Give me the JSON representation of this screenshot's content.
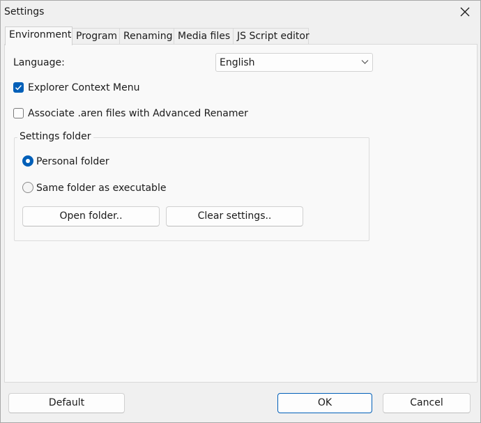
{
  "window": {
    "title": "Settings"
  },
  "icons": {
    "close": "close-icon",
    "dropdown": "chevron-down-icon",
    "check": "checkmark-icon"
  },
  "tabs": [
    {
      "label": "Environment",
      "active": true
    },
    {
      "label": "Program",
      "active": false
    },
    {
      "label": "Renaming",
      "active": false
    },
    {
      "label": "Media files",
      "active": false
    },
    {
      "label": "JS Script editor",
      "active": false
    }
  ],
  "environment": {
    "language_label": "Language:",
    "language_value": "English",
    "explorer_context_menu": {
      "label": "Explorer Context Menu",
      "checked": true
    },
    "associate_aren": {
      "label": "Associate .aren files with Advanced Renamer",
      "checked": false
    },
    "settings_folder": {
      "title": "Settings folder",
      "options": [
        {
          "label": "Personal folder",
          "selected": true
        },
        {
          "label": "Same folder as executable",
          "selected": false
        }
      ],
      "open_folder_label": "Open folder..",
      "clear_settings_label": "Clear settings.."
    }
  },
  "footer": {
    "default_label": "Default",
    "ok_label": "OK",
    "cancel_label": "Cancel"
  },
  "colors": {
    "accent": "#005fb8",
    "window_bg": "#f0f0f0",
    "panel_bg": "#f9f9f9"
  }
}
